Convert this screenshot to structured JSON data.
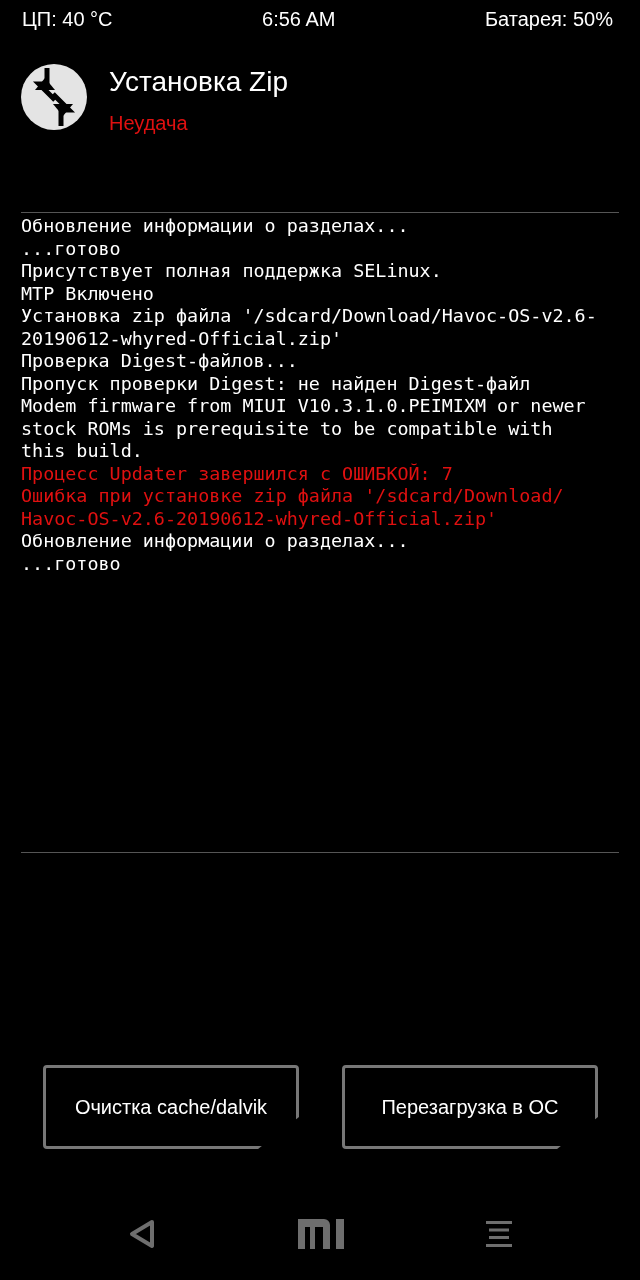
{
  "status_bar": {
    "cpu": "ЦП: 40 °C",
    "time": "6:56 AM",
    "battery": "Батарея: 50%"
  },
  "header": {
    "title": "Установка Zip",
    "status": "Неудача"
  },
  "log": [
    {
      "kind": "info",
      "text": "Обновление информации о разделах..."
    },
    {
      "kind": "info",
      "text": "...готово"
    },
    {
      "kind": "info",
      "text": "Присутствует полная поддержка SELinux."
    },
    {
      "kind": "info",
      "text": "MTP Включено"
    },
    {
      "kind": "info",
      "text": "Установка zip файла '/sdcard/Download/Havoc-OS-v2.6-"
    },
    {
      "kind": "info",
      "text": "20190612-whyred-Official.zip'"
    },
    {
      "kind": "info",
      "text": "Проверка Digest-файлов..."
    },
    {
      "kind": "info",
      "text": "Пропуск проверки Digest: не найден Digest-файл"
    },
    {
      "kind": "info",
      "text": "Modem firmware from MIUI V10.3.1.0.PEIMIXM or newer"
    },
    {
      "kind": "info",
      "text": "stock ROMs is prerequisite to be compatible with"
    },
    {
      "kind": "info",
      "text": "this build."
    },
    {
      "kind": "error",
      "text": "Процесс Updater завершился с ОШИБКОЙ: 7"
    },
    {
      "kind": "error",
      "text": "Ошибка при установке zip файла '/sdcard/Download/"
    },
    {
      "kind": "error",
      "text": "Havoc-OS-v2.6-20190612-whyred-Official.zip'"
    },
    {
      "kind": "info",
      "text": "Обновление информации о разделах..."
    },
    {
      "kind": "info",
      "text": "...готово"
    }
  ],
  "buttons": [
    "Очистка cache/dalvik",
    "Перезагрузка в ОС"
  ]
}
